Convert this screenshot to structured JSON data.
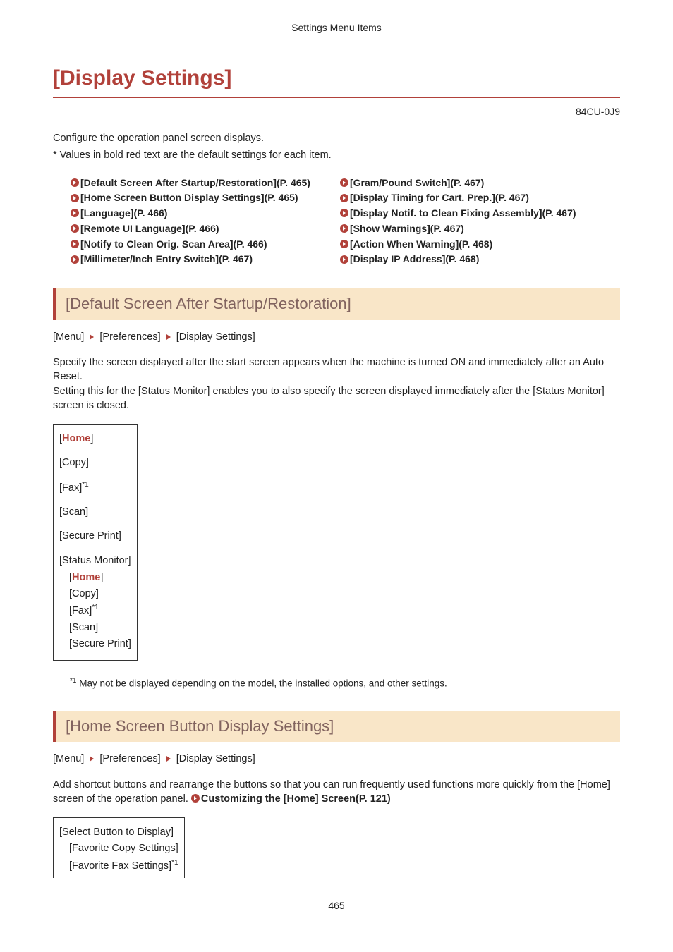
{
  "header": "Settings Menu Items",
  "title": "[Display Settings]",
  "doc_code": "84CU-0J9",
  "intro": "Configure the operation panel screen displays.",
  "note": "* Values in bold red text are the default settings for each item.",
  "links_left": [
    "[Default Screen After Startup/Restoration](P. 465)",
    "[Home Screen Button Display Settings](P. 465)",
    "[Language](P. 466)",
    "[Remote UI Language](P. 466)",
    "[Notify to Clean Orig. Scan Area](P. 466)",
    "[Millimeter/Inch Entry Switch](P. 467)"
  ],
  "links_right": [
    "[Gram/Pound Switch](P. 467)",
    "[Display Timing for Cart. Prep.](P. 467)",
    "[Display Notif. to Clean Fixing Assembly](P. 467)",
    "[Show Warnings](P. 467)",
    "[Action When Warning](P. 468)",
    "[Display IP Address](P. 468)"
  ],
  "section1": {
    "heading": "[Default Screen After Startup/Restoration]",
    "breadcrumb": [
      "[Menu]",
      "[Preferences]",
      "[Display Settings]"
    ],
    "desc1": "Specify the screen displayed after the start screen appears when the machine is turned ON and immediately after an Auto Reset.",
    "desc2": "Setting this for the [Status Monitor] enables you to also specify the screen displayed immediately after the [Status Monitor] screen is closed.",
    "options": {
      "home": "Home",
      "copy": "[Copy]",
      "fax_pre": "[Fax]",
      "sup": "*1",
      "scan": "[Scan]",
      "secure": "[Secure Print]",
      "status": "[Status Monitor]",
      "sub_home": "Home",
      "sub_copy": "[Copy]",
      "sub_fax_pre": "[Fax]",
      "sub_scan": "[Scan]",
      "sub_secure": "[Secure Print]"
    },
    "footnote_sup": "*1",
    "footnote": " May not be displayed depending on the model, the installed options, and other settings."
  },
  "section2": {
    "heading": "[Home Screen Button Display Settings]",
    "breadcrumb": [
      "[Menu]",
      "[Preferences]",
      "[Display Settings]"
    ],
    "desc_pre": "Add shortcut buttons and rearrange the buttons so that you can run frequently used functions more quickly from the [Home] screen of the operation panel. ",
    "link_text": "Customizing the [Home] Screen(P. 121)",
    "options": {
      "select": "[Select Button to Display]",
      "fav_copy": "[Favorite Copy Settings]",
      "fav_fax_pre": "[Favorite Fax Settings]",
      "sup": "*1"
    }
  },
  "page_num": "465"
}
